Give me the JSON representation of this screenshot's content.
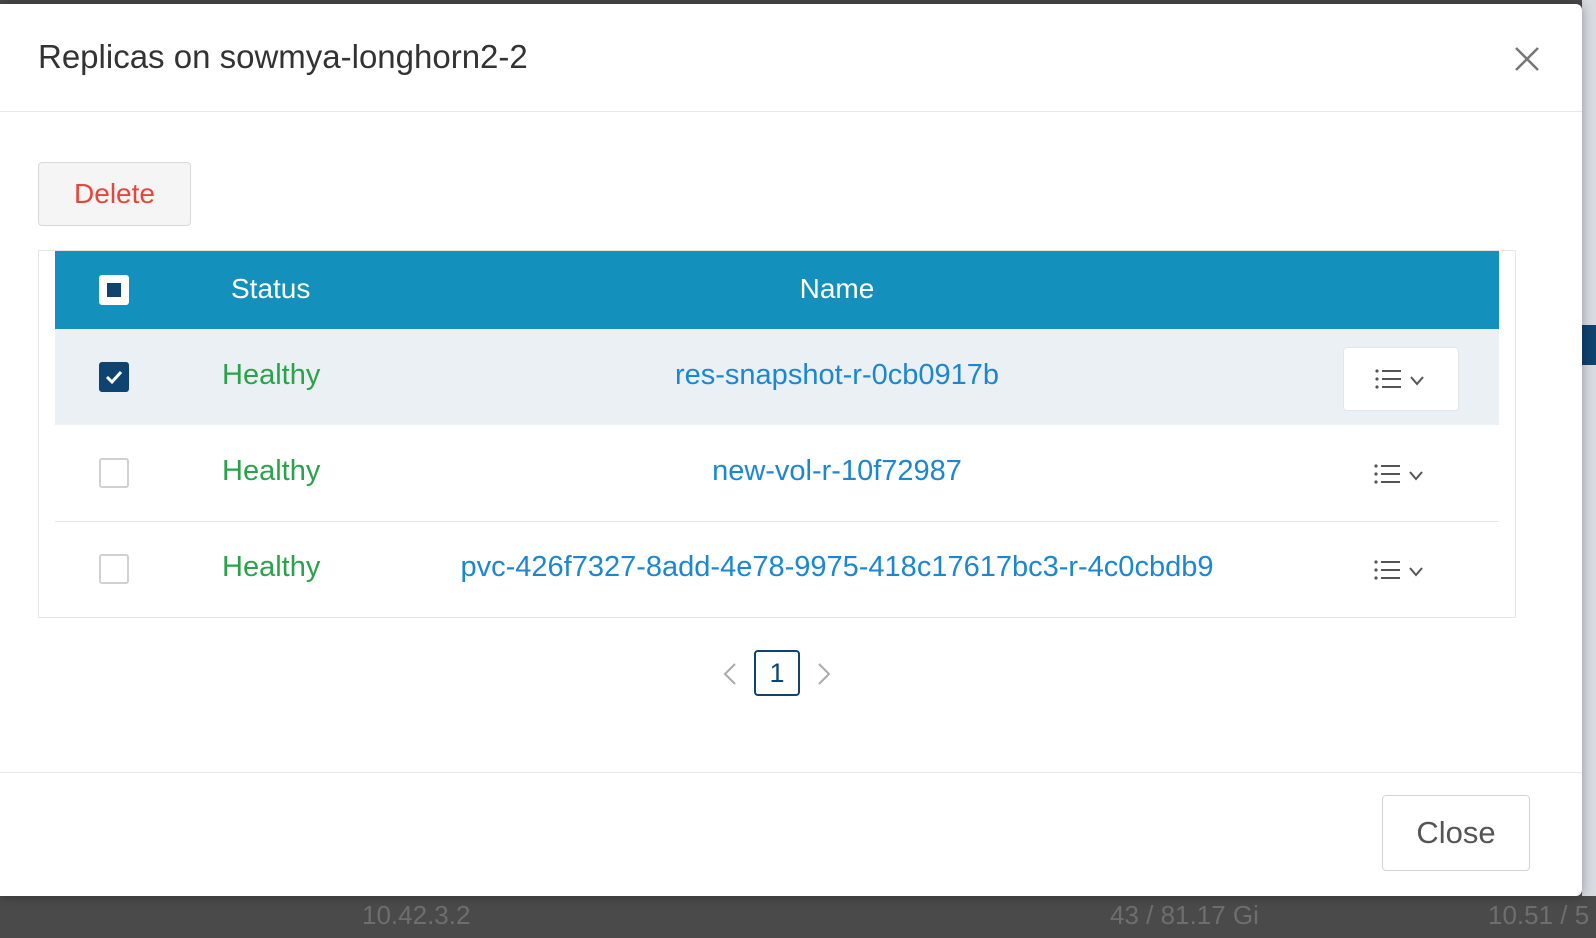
{
  "modal": {
    "title": "Replicas on sowmya-longhorn2-2",
    "delete_label": "Delete",
    "close_label": "Close"
  },
  "table": {
    "columns": [
      "Status",
      "Name"
    ],
    "rows": [
      {
        "status": "Healthy",
        "name": "res-snapshot-r-0cb0917b",
        "selected": true
      },
      {
        "status": "Healthy",
        "name": "new-vol-r-10f72987",
        "selected": false
      },
      {
        "status": "Healthy",
        "name": "pvc-426f7327-8add-4e78-9975-418c17617bc3-r-4c0cbdb9",
        "selected": false
      }
    ]
  },
  "pagination": {
    "current_page": "1"
  },
  "background": {
    "ip": "10.42.3.2",
    "disk": "43 / 81.17 Gi",
    "cpu": "10.51 / 5"
  },
  "icons": {
    "close": "close-icon",
    "actions": "list-icon",
    "dropdown": "chevron-down-icon",
    "prev": "chevron-left-icon",
    "next": "chevron-right-icon",
    "checkbox_checked": "check-icon"
  },
  "colors": {
    "header": "#1490bd",
    "healthy": "#2aa24a",
    "link": "#1b87d2",
    "delete": "#e8453c",
    "primary": "#0f4470",
    "selected_row": "#ebf0f4"
  }
}
